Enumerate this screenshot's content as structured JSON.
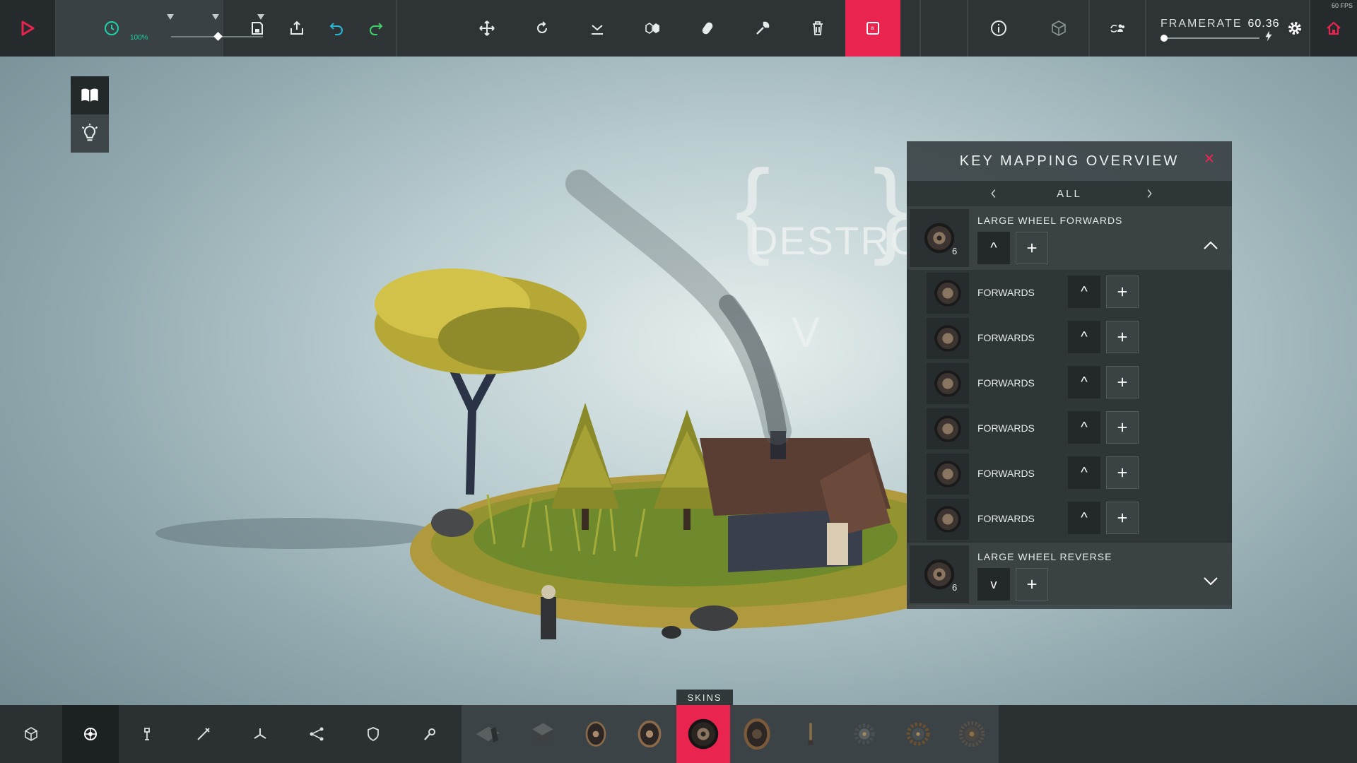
{
  "topbar": {
    "time_scale_label": "100%",
    "framerate_label": "FRAMERATE",
    "framerate_value": "60.36",
    "fps_badge": "60 FPS",
    "time_scale_slider_fraction": 0.5,
    "framerate_slider_fraction": 0.0,
    "icons": {
      "play": "play-icon",
      "time": "clock-icon",
      "save": "save-icon",
      "load": "load-icon",
      "undo": "undo-icon",
      "redo": "redo-icon",
      "move": "move-icon",
      "rotate": "rotate-icon",
      "extend": "extend-icon",
      "mirror": "mirror-icon",
      "bind": "bind-icon",
      "tweak": "wrench-icon",
      "delete": "trash-icon",
      "keymap": "key-mapper-icon",
      "info": "info-icon",
      "physics": "cube-icon",
      "multiplayer": "multiplayer-icon",
      "settings": "gear-icon",
      "home": "home-icon"
    },
    "accent_color": "#e8244f",
    "time_color": "#1ed1a8"
  },
  "side": {
    "items": [
      {
        "name": "book-icon"
      },
      {
        "name": "lightbulb-icon"
      }
    ]
  },
  "scene": {
    "word_1": "DESTROY",
    "word_2": "V"
  },
  "keymap": {
    "title": "KEY MAPPING OVERVIEW",
    "filter": "ALL",
    "groups": [
      {
        "name": "LARGE WHEEL FORWARDS",
        "count": "6",
        "key": "^",
        "expanded": true,
        "items": [
          {
            "label": "FORWARDS",
            "key": "^"
          },
          {
            "label": "FORWARDS",
            "key": "^"
          },
          {
            "label": "FORWARDS",
            "key": "^"
          },
          {
            "label": "FORWARDS",
            "key": "^"
          },
          {
            "label": "FORWARDS",
            "key": "^"
          },
          {
            "label": "FORWARDS",
            "key": "^"
          }
        ]
      },
      {
        "name": "LARGE WHEEL REVERSE",
        "count": "6",
        "key": "v",
        "expanded": false
      }
    ]
  },
  "bottom": {
    "skins_label": "SKINS",
    "categories": [
      {
        "icon": "cube-icon"
      },
      {
        "icon": "wheel-category-icon",
        "active": true
      },
      {
        "icon": "piston-icon"
      },
      {
        "icon": "weapon-icon"
      },
      {
        "icon": "flight-icon"
      },
      {
        "icon": "joint-icon"
      },
      {
        "icon": "shield-icon"
      },
      {
        "icon": "utility-icon"
      }
    ],
    "blocks": [
      {
        "icon": "steering-hinge-icon"
      },
      {
        "icon": "steering-block-icon"
      },
      {
        "icon": "small-wheel-icon"
      },
      {
        "icon": "wheel-icon"
      },
      {
        "icon": "large-wheel-icon",
        "active": true
      },
      {
        "icon": "unpowered-wheel-icon"
      },
      {
        "icon": "suspension-icon"
      },
      {
        "icon": "cog-icon"
      },
      {
        "icon": "large-cog-icon"
      },
      {
        "icon": "gear-block-icon"
      }
    ]
  }
}
